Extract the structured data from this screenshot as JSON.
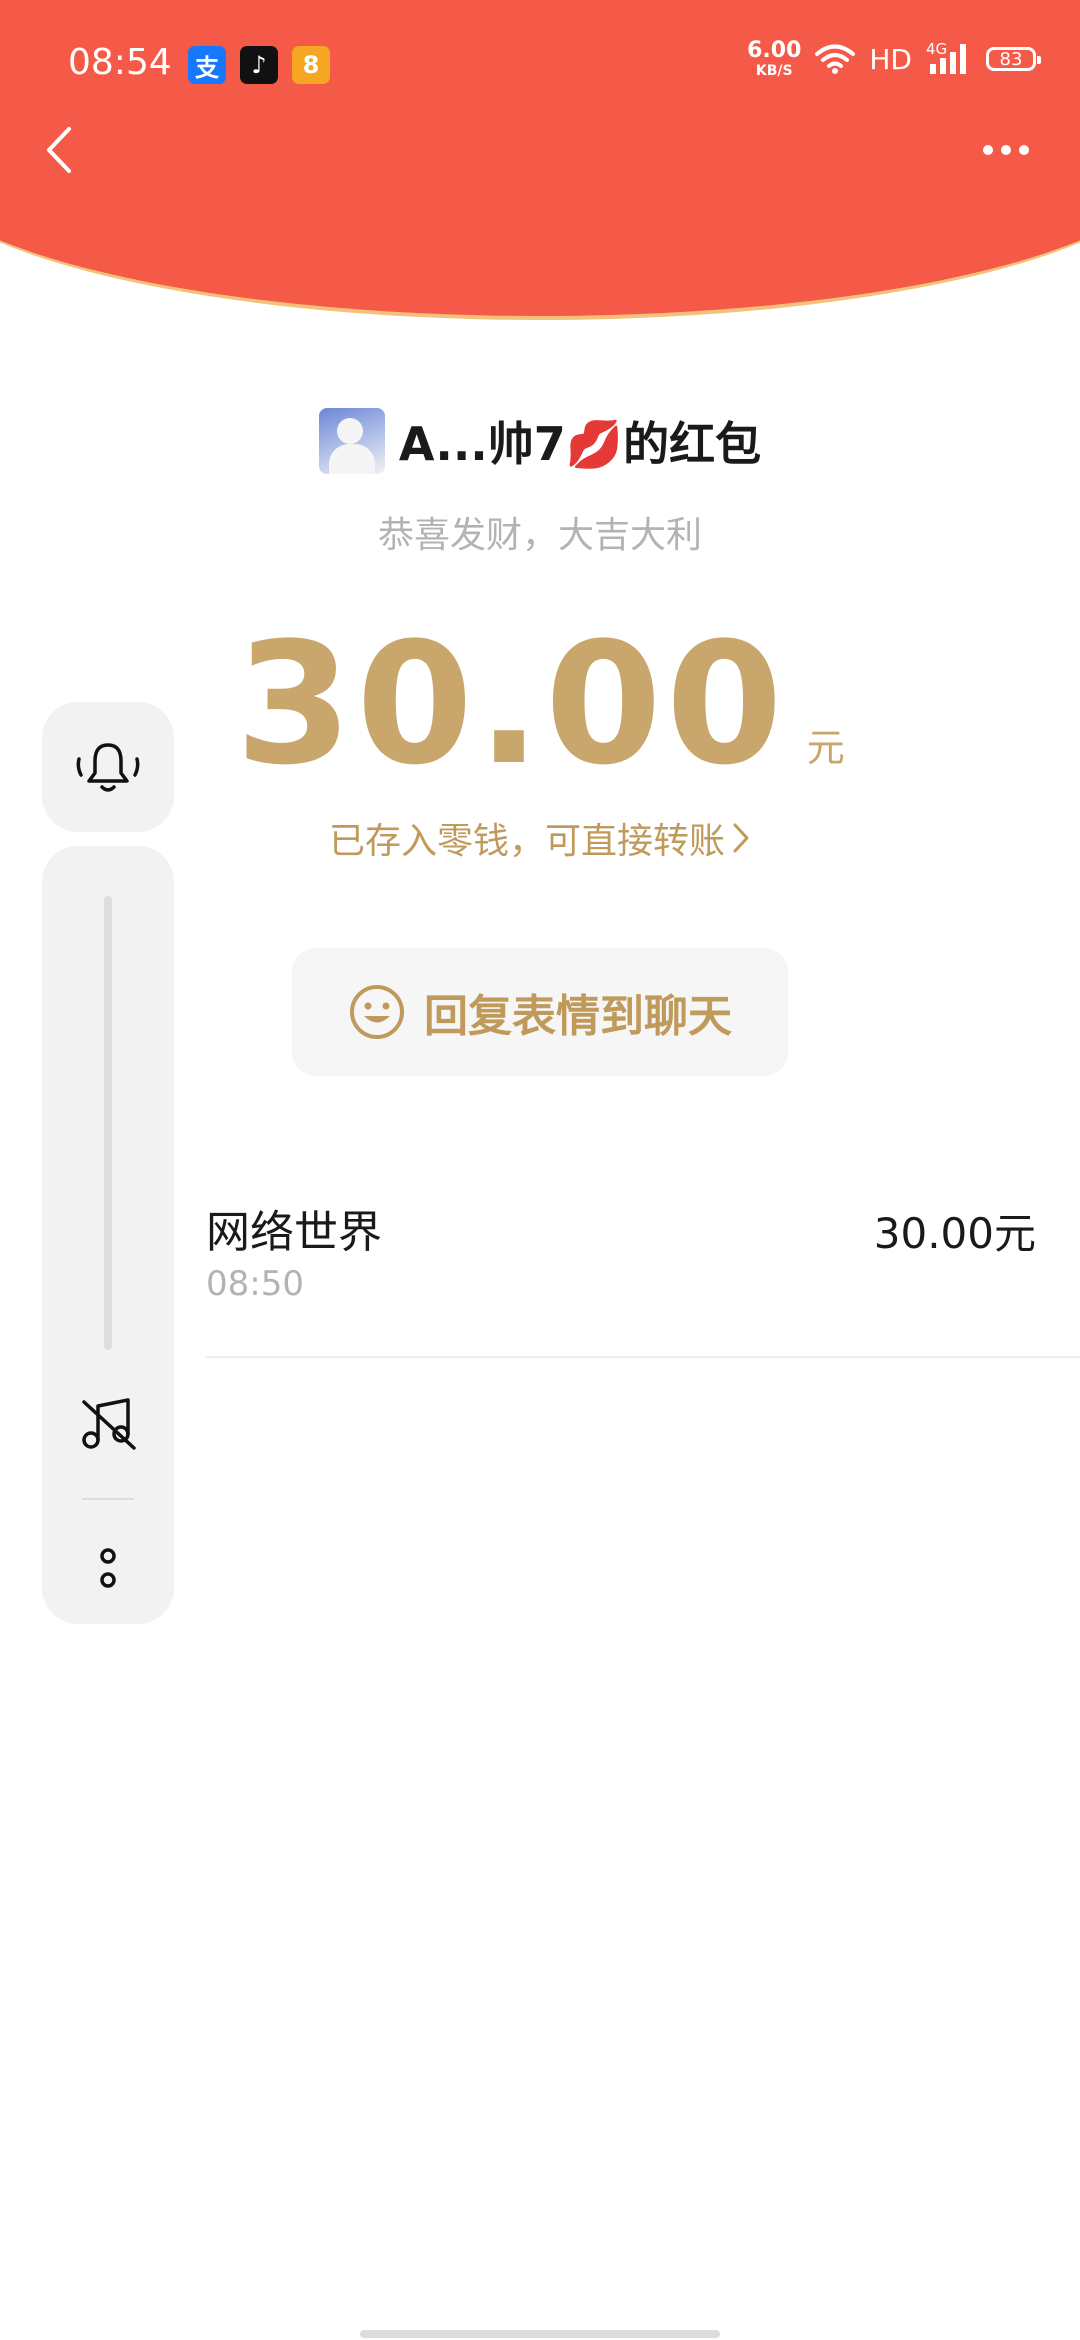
{
  "status_bar": {
    "time": "08:54",
    "app_icons": [
      "alipay-icon",
      "tiktok-icon",
      "shopping-app-icon"
    ],
    "app_glyphs": [
      "支",
      "♪",
      "8"
    ],
    "net_speed_value": "6.00",
    "net_speed_unit": "KB/S",
    "hd_label": "HD",
    "network_type": "4G",
    "battery": "83"
  },
  "nav": {
    "back_icon": "chevron-left-icon",
    "more_icon": "more-dots-icon"
  },
  "sender": {
    "name": "A...帅7💋的红包",
    "blessing": "恭喜发财，大吉大利"
  },
  "amount": {
    "value": "30.00",
    "unit": "元",
    "saved_note": "已存入零钱，可直接转账"
  },
  "reply_button": {
    "label": "回复表情到聊天",
    "icon": "smiley-icon"
  },
  "record": {
    "name": "网络世界",
    "time": "08:50",
    "amount": "30.00元"
  },
  "side_panel": {
    "icons": [
      "bell-icon",
      "music-off-icon",
      "more-vertical-icon"
    ]
  },
  "colors": {
    "header_red": "#F55A48",
    "header_edge": "#F3C27A",
    "gold": "#C9A66B"
  }
}
